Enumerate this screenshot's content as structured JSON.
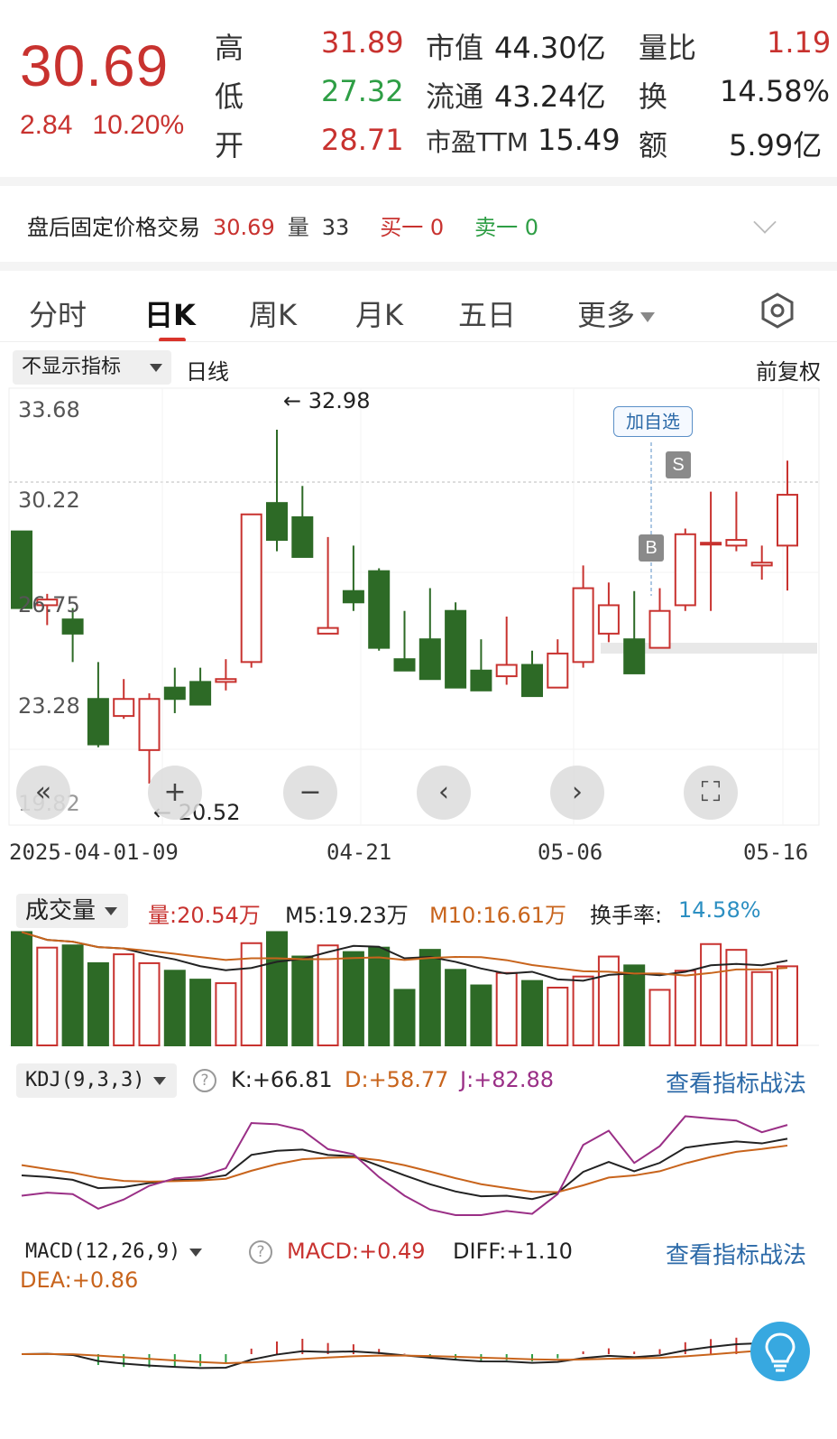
{
  "quote": {
    "price": "30.69",
    "change": "2.84",
    "change_pct": "10.20%",
    "stats": [
      {
        "label": "高",
        "value": "31.89",
        "tone": "red"
      },
      {
        "label": "低",
        "value": "27.32",
        "tone": "green"
      },
      {
        "label": "开",
        "value": "28.71",
        "tone": "red"
      },
      {
        "label": "市值",
        "value": "44.30亿",
        "tone": "dark"
      },
      {
        "label": "流通",
        "value": "43.24亿",
        "tone": "dark"
      },
      {
        "label": "市盈TTM",
        "value": "15.49",
        "tone": "dark"
      },
      {
        "label": "量比",
        "value": "1.19",
        "tone": "red"
      },
      {
        "label": "换",
        "value": "14.58%",
        "tone": "dark"
      },
      {
        "label": "额",
        "value": "5.99亿",
        "tone": "dark"
      }
    ]
  },
  "after_hours": {
    "label": "盘后固定价格交易",
    "price": "30.69",
    "volume_label": "量",
    "volume": "33",
    "buy1": "买一 0",
    "sell1": "卖一 0"
  },
  "tabs": [
    "分时",
    "日K",
    "周K",
    "月K",
    "五日",
    "更多"
  ],
  "active_tab": "日K",
  "indicator_bar": {
    "select": "不显示指标",
    "line": "日线",
    "adjust": "前复权"
  },
  "kline": {
    "price_labels": [
      "33.68",
      "30.22",
      "26.75",
      "23.28",
      "19.82"
    ],
    "high_note": "32.98",
    "low_note": "20.52",
    "add_watchlist": "加自选",
    "signal_buy": "B",
    "signal_sell": "S",
    "dates": [
      "2025-04-01-09",
      "04-21",
      "05-06",
      "05-16"
    ],
    "ohlc": [
      [
        29.4,
        29.3,
        26.7,
        26.7
      ],
      [
        26.8,
        27.2,
        26.1,
        27.0
      ],
      [
        26.3,
        26.7,
        24.8,
        25.8
      ],
      [
        23.5,
        24.8,
        21.8,
        21.9
      ],
      [
        22.9,
        24.2,
        22.8,
        23.5
      ],
      [
        21.7,
        23.7,
        20.52,
        23.5
      ],
      [
        23.9,
        24.6,
        23.0,
        23.5
      ],
      [
        24.1,
        24.6,
        23.3,
        23.3
      ],
      [
        24.1,
        24.9,
        23.8,
        24.2
      ],
      [
        24.8,
        30.0,
        24.6,
        30.0
      ],
      [
        30.4,
        32.98,
        28.7,
        29.1
      ],
      [
        29.9,
        31.0,
        29.0,
        28.5
      ],
      [
        25.8,
        29.2,
        25.8,
        26.0
      ],
      [
        27.3,
        28.9,
        26.6,
        26.9
      ],
      [
        28.0,
        28.1,
        25.2,
        25.3
      ],
      [
        24.9,
        26.6,
        24.5,
        24.5
      ],
      [
        25.6,
        27.4,
        24.2,
        24.2
      ],
      [
        26.6,
        26.9,
        23.9,
        23.9
      ],
      [
        24.5,
        25.6,
        23.8,
        23.8
      ],
      [
        24.3,
        26.4,
        24.0,
        24.7
      ],
      [
        24.7,
        25.2,
        23.6,
        23.6
      ],
      [
        23.9,
        25.6,
        23.9,
        25.1
      ],
      [
        24.8,
        28.2,
        24.6,
        27.4
      ],
      [
        25.8,
        27.6,
        25.5,
        26.8
      ],
      [
        25.6,
        27.3,
        25.1,
        24.4
      ],
      [
        25.3,
        27.4,
        25.3,
        26.6
      ],
      [
        26.8,
        29.5,
        26.6,
        29.3
      ],
      [
        29.0,
        30.8,
        26.6,
        29.0
      ],
      [
        28.9,
        30.8,
        28.7,
        29.1
      ],
      [
        28.2,
        28.9,
        27.7,
        28.3
      ],
      [
        28.9,
        31.89,
        27.32,
        30.69
      ]
    ]
  },
  "volume": {
    "title": "成交量",
    "vol": "量:20.54万",
    "m5": "M5:19.23万",
    "m10": "M10:16.61万",
    "turnover_label": "换手率:",
    "turnover": "14.58%",
    "values": [
      25.5,
      22,
      22.5,
      18.5,
      20.5,
      18.5,
      16.8,
      14.8,
      14,
      23,
      25.5,
      20,
      22.5,
      21,
      22,
      12.5,
      21.5,
      17,
      13.5,
      16.3,
      14.5,
      13,
      15.5,
      20,
      18,
      12.5,
      16.8,
      22.8,
      21.5,
      16.5,
      17.8
    ]
  },
  "kdj": {
    "title": "KDJ(9,3,3)",
    "k": "K:+66.81",
    "d": "D:+58.77",
    "j": "J:+82.88",
    "strategy": "查看指标战法"
  },
  "macd": {
    "title": "MACD(12,26,9)",
    "macd": "MACD:+0.49",
    "diff": "DIFF:+1.10",
    "dea": "DEA:+0.86",
    "strategy": "查看指标战法"
  },
  "colors": {
    "up": "#c8322f",
    "down": "#2d6a26",
    "accent": "#d9342b",
    "link": "#2c6aa8"
  }
}
